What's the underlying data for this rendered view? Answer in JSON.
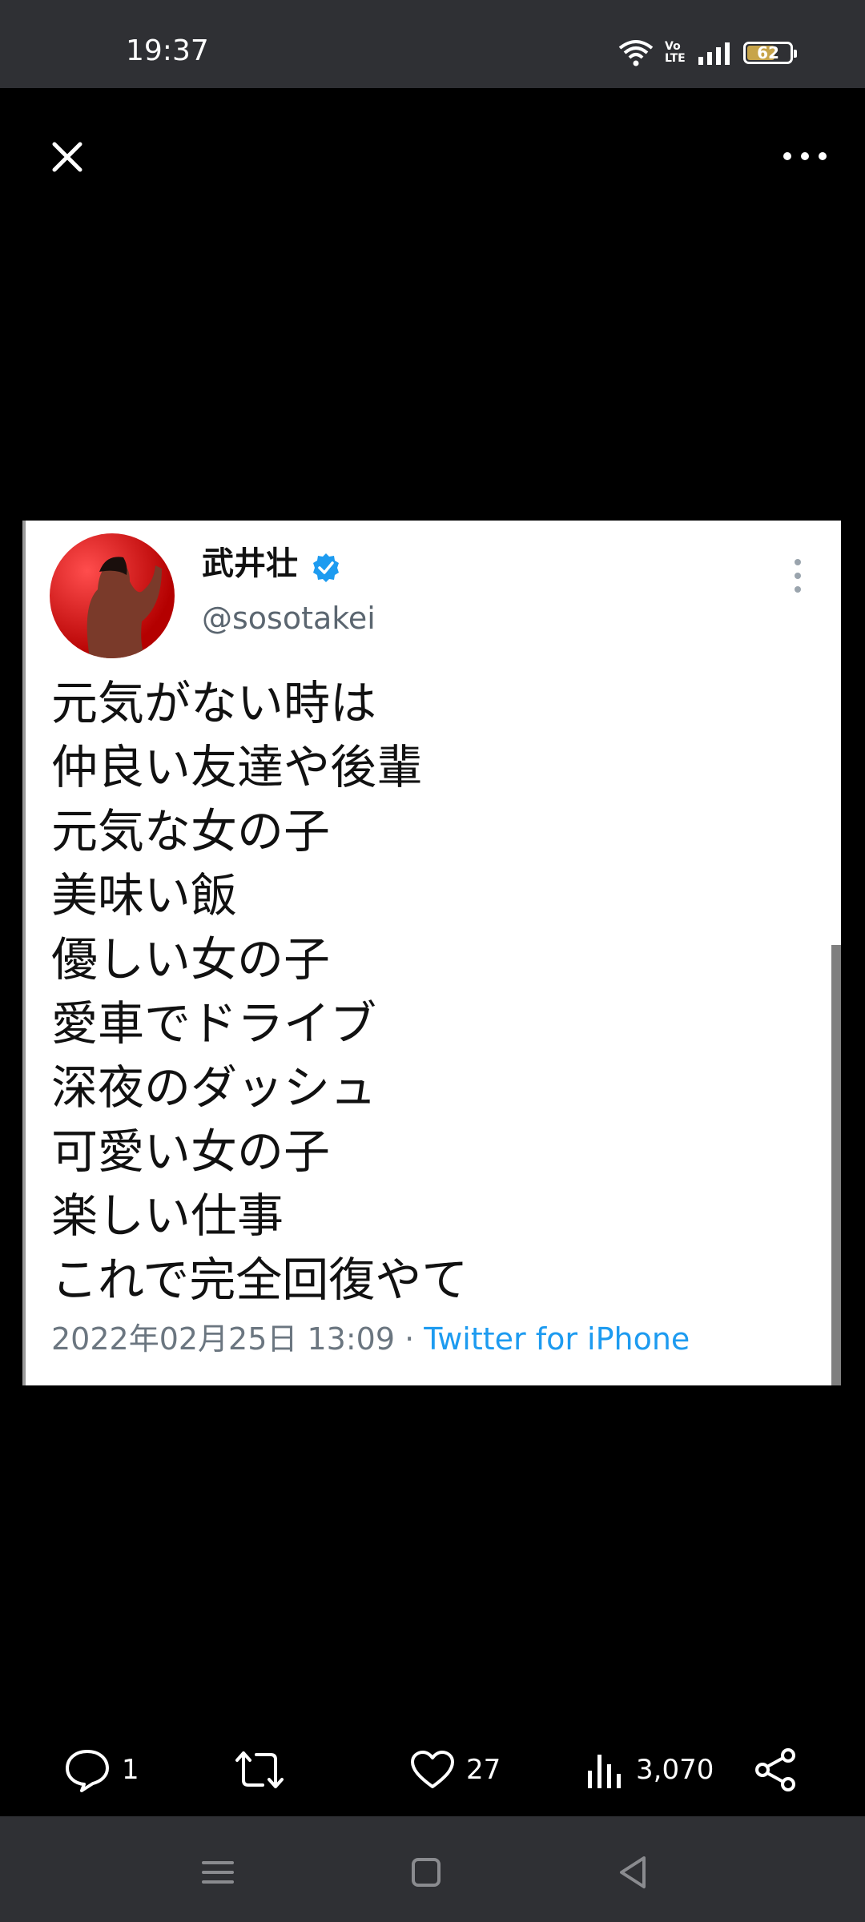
{
  "status": {
    "time": "19:37",
    "battery_level": "62",
    "network_label": "Vo LTE"
  },
  "tweet": {
    "display_name": "武井壮",
    "handle": "@sosotakei",
    "lines": [
      "元気がない時は",
      "仲良い友達や後輩",
      "元気な女の子",
      "美味い飯",
      "優しい女の子",
      "愛車でドライブ",
      "深夜のダッシュ",
      "可愛い女の子",
      "楽しい仕事",
      "これで完全回復やて"
    ],
    "timestamp": "2022年02月25日 13:09",
    "separator": " · ",
    "source": "Twitter for iPhone"
  },
  "actions": {
    "reply_count": "1",
    "like_count": "27",
    "view_count": "3,070"
  },
  "colors": {
    "accent": "#1d9bf0",
    "verified": "#1d9bf0",
    "status_bar": "#2f3034"
  },
  "icons": [
    "close-icon",
    "more-icon",
    "wifi-icon",
    "signal-icon",
    "battery-icon",
    "verified-icon",
    "reply-icon",
    "retweet-icon",
    "like-icon",
    "views-icon",
    "share-icon",
    "nav-menu-icon",
    "nav-home-icon",
    "nav-back-icon"
  ]
}
